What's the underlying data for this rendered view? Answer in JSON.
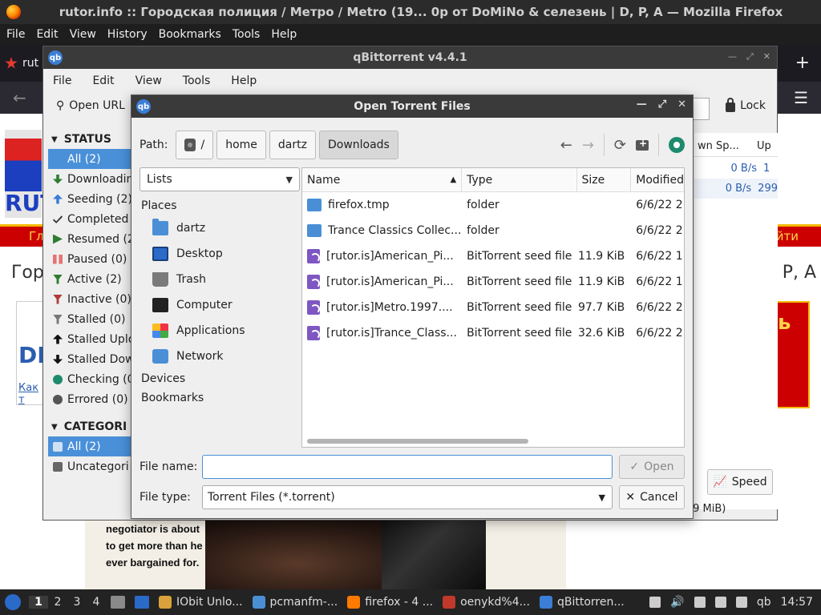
{
  "firefox": {
    "title": "rutor.info :: Городская полиция / Метро / Metro (19... 0p от DoMiNo & селезень | D, P, A — Mozilla Firefox",
    "menu": [
      "File",
      "Edit",
      "View",
      "History",
      "Bookmarks",
      "Tools",
      "Help"
    ],
    "tab_label": "rut",
    "new_tab": "+",
    "page": {
      "site_short": "RUT",
      "nav_left": "Гл",
      "nav_right": "йти",
      "heading_left": "Гор",
      "heading_right": "P, A",
      "ad_title": "DL",
      "ad_link": "Как т",
      "ad_badge": "ь",
      "poster_lines": [
        "negotiator is about",
        "to get more than he",
        "ever bargained for."
      ]
    }
  },
  "qbittorrent": {
    "title": "qBittorrent v4.4.1",
    "menu": [
      "File",
      "Edit",
      "View",
      "Tools",
      "Help"
    ],
    "open_url": "Open URL",
    "lock": "Lock",
    "status_header": "STATUS",
    "status_items": [
      {
        "label": "All (2)",
        "icon": "filter-icon",
        "color": "#4a90d9",
        "selected": true
      },
      {
        "label": "Downloadin",
        "icon": "arrow-down-icon",
        "color": "#2e7d32",
        "selected": false
      },
      {
        "label": "Seeding (2)",
        "icon": "arrow-up-icon",
        "color": "#3b7ed6",
        "selected": false
      },
      {
        "label": "Completed",
        "icon": "check-icon",
        "color": "#333333",
        "selected": false
      },
      {
        "label": "Resumed (2",
        "icon": "play-icon",
        "color": "#2e7d32",
        "selected": false
      },
      {
        "label": "Paused (0)",
        "icon": "pause-icon",
        "color": "#e57373",
        "selected": false
      },
      {
        "label": "Active (2)",
        "icon": "filter-icon",
        "color": "#2e7d32",
        "selected": false
      },
      {
        "label": "Inactive (0)",
        "icon": "filter-icon",
        "color": "#b23b3b",
        "selected": false
      },
      {
        "label": "Stalled (0)",
        "icon": "filter-icon",
        "color": "#777777",
        "selected": false
      },
      {
        "label": "Stalled Uplo",
        "icon": "arrow-up-icon",
        "color": "#111111",
        "selected": false
      },
      {
        "label": "Stalled Dow",
        "icon": "arrow-down-icon",
        "color": "#111111",
        "selected": false
      },
      {
        "label": "Checking (0",
        "icon": "gear-icon",
        "color": "#1e8a6e",
        "selected": false
      },
      {
        "label": "Errored (0)",
        "icon": "no-entry-icon",
        "color": "#555555",
        "selected": false
      }
    ],
    "categories_header": "CATEGORI",
    "category_items": [
      {
        "label": "All (2)",
        "selected": true
      },
      {
        "label": "Uncategori",
        "selected": false
      }
    ],
    "columns": {
      "dl_speed": "wn Sp...",
      "up_speed": "Up"
    },
    "rows": [
      {
        "dl": "0 B/s",
        "up": "1"
      },
      {
        "dl": "0 B/s",
        "up": "299"
      }
    ],
    "speed_button": "Speed",
    "status_size": ".9 MiB)"
  },
  "dialog": {
    "title": "Open Torrent Files",
    "path_label": "Path:",
    "path": [
      "/",
      "home",
      "dartz",
      "Downloads"
    ],
    "view_combo": "Lists",
    "places_header": "Places",
    "places": [
      {
        "label": "dartz",
        "icon": "home-folder-icon"
      },
      {
        "label": "Desktop",
        "icon": "desktop-icon"
      },
      {
        "label": "Trash",
        "icon": "trash-icon"
      },
      {
        "label": "Computer",
        "icon": "computer-icon"
      },
      {
        "label": "Applications",
        "icon": "applications-icon"
      },
      {
        "label": "Network",
        "icon": "network-folder-icon"
      }
    ],
    "devices_header": "Devices",
    "bookmarks_header": "Bookmarks",
    "columns": {
      "name": "Name",
      "type": "Type",
      "size": "Size",
      "modified": "Modified"
    },
    "files": [
      {
        "name": "firefox.tmp",
        "type": "folder",
        "size": "",
        "modified": "6/6/22 2:",
        "kind": "folder"
      },
      {
        "name": "Trance Classics Collec...",
        "type": "folder",
        "size": "",
        "modified": "6/6/22 2:",
        "kind": "folder"
      },
      {
        "name": "[rutor.is]American_Pi...",
        "type": "BitTorrent seed file",
        "size": "11.9 KiB",
        "modified": "6/6/22 1:",
        "kind": "torrent"
      },
      {
        "name": "[rutor.is]American_Pi...",
        "type": "BitTorrent seed file",
        "size": "11.9 KiB",
        "modified": "6/6/22 1:",
        "kind": "torrent"
      },
      {
        "name": "[rutor.is]Metro.1997....",
        "type": "BitTorrent seed file",
        "size": "97.7 KiB",
        "modified": "6/6/22 2:",
        "kind": "torrent"
      },
      {
        "name": "[rutor.is]Trance_Class...",
        "type": "BitTorrent seed file",
        "size": "32.6 KiB",
        "modified": "6/6/22 2:",
        "kind": "torrent"
      }
    ],
    "file_name_label": "File name:",
    "file_name_value": "",
    "file_type_label": "File type:",
    "file_type_value": "Torrent Files (*.torrent)",
    "open_button": "Open",
    "cancel_button": "Cancel"
  },
  "taskbar": {
    "workspaces": [
      "1",
      "2",
      "3",
      "4"
    ],
    "current_workspace": "1",
    "tasks": [
      {
        "label": "IObit Unlo...",
        "color": "#d9a23a"
      },
      {
        "label": "pcmanfm-...",
        "color": "#4a8fd6"
      },
      {
        "label": "firefox - 4 ...",
        "color": "#ff7a00"
      },
      {
        "label": "oenykd%4...",
        "color": "#c0392b"
      },
      {
        "label": "qBittorren...",
        "color": "#3b7ed6"
      }
    ],
    "tray_app": "qb",
    "clock": "14:57"
  }
}
